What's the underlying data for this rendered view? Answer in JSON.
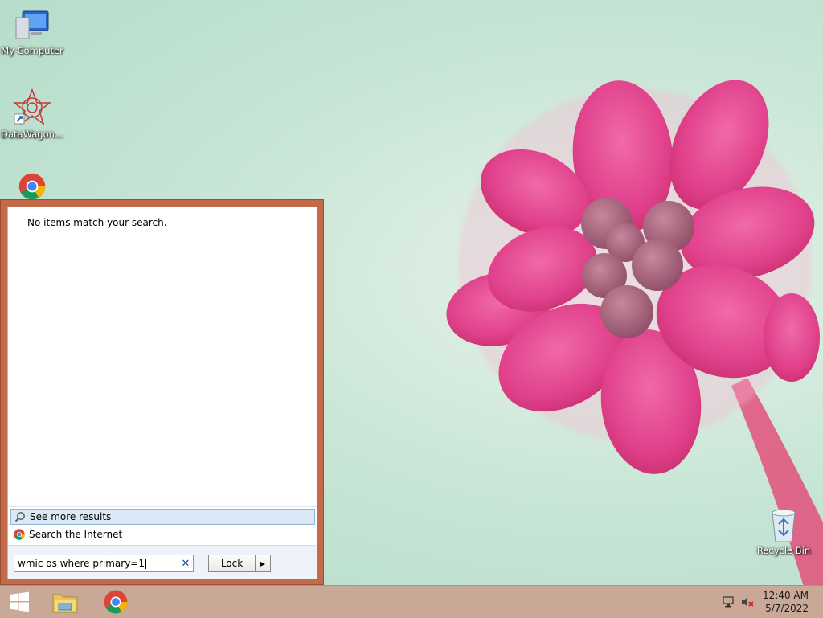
{
  "desktop": {
    "icons": [
      {
        "label": "My Computer",
        "icon": "computer-icon"
      },
      {
        "label": "DataWagon...",
        "icon": "datawagon-icon"
      },
      {
        "label": "",
        "icon": "chrome-icon"
      },
      {
        "label": "Recycle Bin",
        "icon": "recycle-bin-icon"
      }
    ]
  },
  "start_menu": {
    "no_results_text": "No items match your search.",
    "see_more_label": "See more results",
    "search_internet_label": "Search the Internet",
    "search_value": "wmic os where primary=1",
    "clear_symbol": "✕",
    "lock_label": "Lock",
    "lock_arrow": "▶"
  },
  "taskbar": {
    "items": [
      "start-button",
      "file-explorer",
      "chrome"
    ],
    "time": "12:40 AM",
    "date": "5/7/2022"
  },
  "colors": {
    "start_menu_border": "#c26a4a",
    "taskbar": "#c9a898",
    "see_more_highlight": "#dbe8f5"
  }
}
